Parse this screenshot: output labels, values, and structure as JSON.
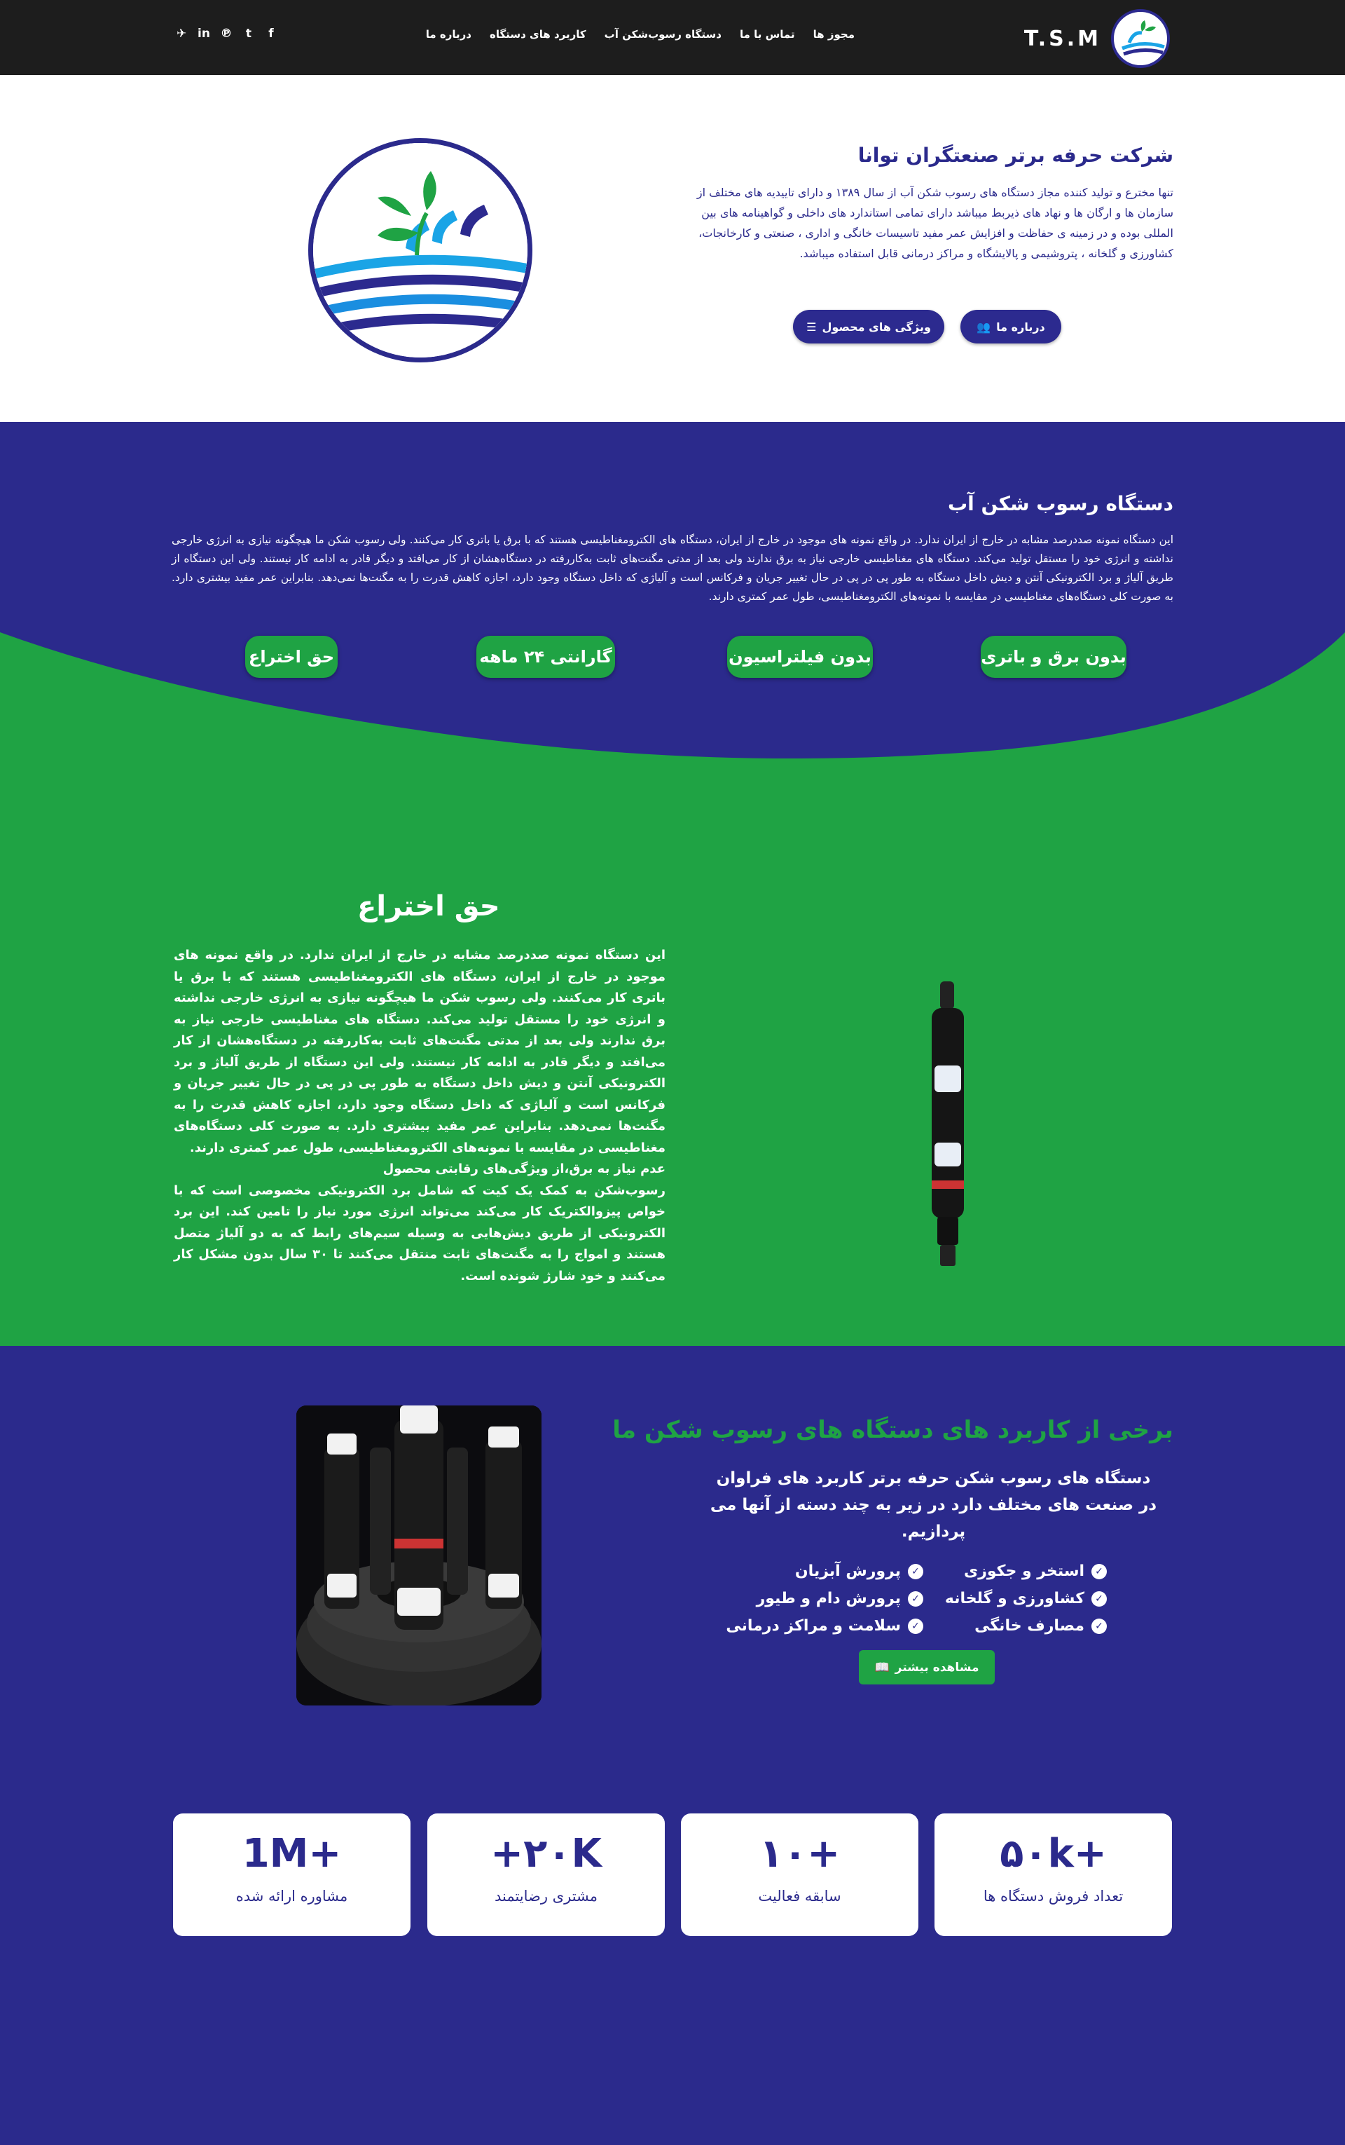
{
  "header": {
    "logo_text": "T.S.M",
    "nav": [
      "مجوز ها",
      "تماس با ما",
      "دستگاه رسوب‌شکن آب",
      "کاربرد های دستگاه",
      "درباره ما"
    ],
    "social": [
      "f",
      "t",
      "p",
      "in",
      "v"
    ]
  },
  "hero": {
    "title": "شرکت حرفه برتر صنعتگران توانا",
    "paragraph": "تنها مخترع و تولید کننده مجاز دستگاه های رسوب شکن آب از سال ۱۳۸۹ و دارای تاییدیه های مختلف از سازمان ها و ارگان ها و نهاد های ذیربط میباشد دارای تمامی استاندارد های داخلی و گواهینامه های بین المللی بوده و در زمینه ی حفاظت و افزایش عمر مفید تاسیسات خانگی و اداری ، صنعتی و کارخانجات، کشاورزی و گلخانه ، پتروشیمی و پالایشگاه و مراکز درمانی قابل استفاده میباشد.",
    "btn_about": "درباره ما",
    "btn_features": "ویژگی های محصول"
  },
  "description": {
    "title": "دستگاه رسوب شکن آب",
    "text": "این دستگاه نمونه صددرصد مشابه در خارج از ایران ندارد. در واقع نمونه های موجود در خارج از ایران، دستگاه های الکترومغناطیسی هستند که با برق یا باتری کار می‌کنند. ولی رسوب شکن ما هیچگونه نیازی به انرژی خارجی نداشته و انرژی خود را مستقل تولید می‌کند. دستگاه های مغناطیسی خارجی نیاز به برق ندارند ولی بعد از مدتی مگنت‌های ثابت به‌کاررفته در دستگاه‌هشان از کار می‌افتد و دیگر قادر به ادامه کار نیستند. ولی این دستگاه از طریق آلیاژ و برد الکترونیکی آنتن و دیش داخل دستگاه به طور پی در پی در حال تغییر جریان و فرکانس است و آلیاژی که داخل دستگاه وجود دارد، اجازه کاهش قدرت را به مگنت‌ها نمی‌دهد. بنابراین عمر مفید بیشتری دارد. به صورت کلی دستگاه‌های مغناطیسی در مقایسه با نمونه‌های الکترومغناطیسی، طول عمر کمتری دارند.",
    "pills": [
      "بدون برق و باتری",
      "بدون فیلتراسیون",
      "گارانتی ۲۴ ماهه",
      "حق اختراع"
    ]
  },
  "patent": {
    "title": "حق اختراع",
    "text": "این دستگاه نمونه صددرصد مشابه در خارج از ایران ندارد. در واقع نمونه های موجود در خارج از ایران، دستگاه های الکترومغناطیسی هستند که با برق یا باتری کار می‌کنند. ولی رسوب شکن ما هیچگونه نیازی به انرژی خارجی نداشته و انرژی خود را مستقل تولید می‌کند. دستگاه های مغناطیسی خارجی نیاز به برق ندارند ولی بعد از مدتی مگنت‌های ثابت به‌کاررفته در دستگاه‌هشان از کار می‌افتد و دیگر قادر به ادامه کار نیستند. ولی این دستگاه از طریق آلیاژ و برد الکترونیکی آنتن و دیش داخل دستگاه به طور پی در پی در حال تغییر جریان و فرکانس است و آلیاژی که داخل دستگاه وجود دارد، اجازه کاهش قدرت را به مگنت‌ها نمی‌دهد. بنابراین عمر مفید بیشتری دارد. به صورت کلی دستگاه‌های مغناطیسی در مقایسه با نمونه‌های الکترومغناطیسی، طول عمر کمتری دارند.",
    "subhead": "عدم نیاز به برق،از ویژگی‌های رقابتی محصول",
    "text2": "رسوب‌شکن به کمک یک کیت که شامل برد الکترونیکی مخصوصی است که با خواص پیزوالکتریک کار می‌کند می‌تواند انرژی مورد نیاز را تامین کند. این برد الکترونیکی از طریق دیش‌هایی به وسیله سیم‌های رابط که به دو آلیاژ متصل هستند و امواج را به مگنت‌های ثابت منتقل می‌کنند تا ۳۰ سال بدون مشکل کار می‌کنند و خود شارژ شونده است."
  },
  "applications": {
    "title": "برخی از کاربرد های دستگاه های رسوب شکن ما",
    "lead": "دستگاه های رسوب شکن حرفه برتر کاربرد های فراوان در صنعت های مختلف دارد در زیر به چند دسته از آنها می پردازیم.",
    "col_right": [
      "استخر و جکوزی",
      "کشاورزی و گلخانه",
      "مصارف خانگی"
    ],
    "col_left": [
      "پرورش آبزیان",
      "پرورش دام و طیور",
      "سلامت و مراکز درمانی"
    ],
    "more_label": "مشاهده بیشتر"
  },
  "stats": [
    {
      "num": "۵۰k+",
      "label": "تعداد فروش دستگاه ها"
    },
    {
      "num": "۱۰+",
      "label": "سابقه فعالیت"
    },
    {
      "num": "+۲۰K",
      "label": "مشتری رضایتمند"
    },
    {
      "num": "1M+",
      "label": "مشاوره ارائه شده"
    }
  ],
  "colors": {
    "primary": "#2b2a8c",
    "green": "#1fa344",
    "header": "#1d1d1d"
  }
}
